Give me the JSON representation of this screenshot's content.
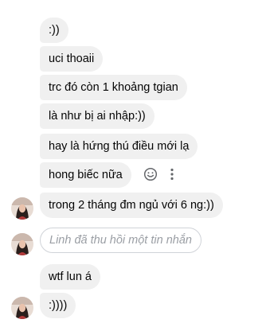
{
  "messages": [
    {
      "text": ":))"
    },
    {
      "text": "uci thoaii"
    },
    {
      "text": "trc đó còn 1 khoảng tgian"
    },
    {
      "text": "là như bị ai nhập:))"
    },
    {
      "text": "hay là hứng thú điều mới lạ"
    },
    {
      "text": "hong biếc nữa"
    },
    {
      "text": "trong 2 tháng đm ngủ với 6 ng:))"
    },
    {
      "text": "Linh đã thu hồi một tin nhắn"
    },
    {
      "text": "wtf lun á"
    },
    {
      "text": ":))))"
    }
  ],
  "colors": {
    "bubble": "#f0f0f0",
    "text": "#050505",
    "recalled_text": "#9a9ea4",
    "icon": "#65676b"
  },
  "icons": [
    "smile-icon",
    "more-options-icon"
  ]
}
